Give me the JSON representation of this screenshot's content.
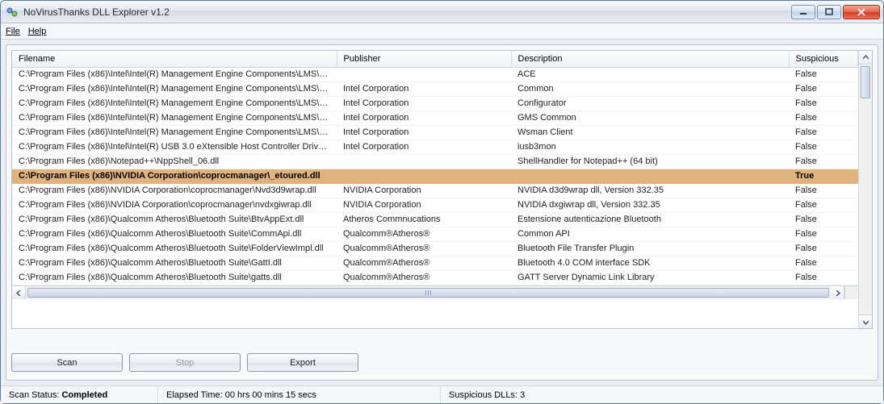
{
  "window": {
    "title": "NoVirusThanks DLL Explorer v1.2"
  },
  "menu": {
    "file": "File",
    "help": "Help"
  },
  "table": {
    "headers": {
      "filename": "Filename",
      "publisher": "Publisher",
      "description": "Description",
      "suspicious": "Suspicious"
    },
    "rows": [
      {
        "filename": "C:\\Program Files (x86)\\Intel\\Intel(R) Management Engine Components\\LMS\\A...",
        "publisher": "",
        "description": "ACE",
        "suspicious": "False",
        "selected": false
      },
      {
        "filename": "C:\\Program Files (x86)\\Intel\\Intel(R) Management Engine Components\\LMS\\Co...",
        "publisher": "Intel Corporation",
        "description": "Common",
        "suspicious": "False",
        "selected": false
      },
      {
        "filename": "C:\\Program Files (x86)\\Intel\\Intel(R) Management Engine Components\\LMS\\Co...",
        "publisher": "Intel Corporation",
        "description": "Configurator",
        "suspicious": "False",
        "selected": false
      },
      {
        "filename": "C:\\Program Files (x86)\\Intel\\Intel(R) Management Engine Components\\LMS\\G...",
        "publisher": "Intel Corporation",
        "description": "GMS Common",
        "suspicious": "False",
        "selected": false
      },
      {
        "filename": "C:\\Program Files (x86)\\Intel\\Intel(R) Management Engine Components\\LMS\\W...",
        "publisher": "Intel Corporation",
        "description": "Wsman Client",
        "suspicious": "False",
        "selected": false
      },
      {
        "filename": "C:\\Program Files (x86)\\Intel\\Intel(R) USB 3.0 eXtensible Host Controller Driver...",
        "publisher": "Intel Corporation",
        "description": "iusb3mon",
        "suspicious": "False",
        "selected": false
      },
      {
        "filename": "C:\\Program Files (x86)\\Notepad++\\NppShell_06.dll",
        "publisher": "",
        "description": "ShellHandler for Notepad++ (64 bit)",
        "suspicious": "False",
        "selected": false
      },
      {
        "filename": "C:\\Program Files (x86)\\NVIDIA Corporation\\coprocmanager\\_etoured.dll",
        "publisher": "",
        "description": "",
        "suspicious": "True",
        "selected": true
      },
      {
        "filename": "C:\\Program Files (x86)\\NVIDIA Corporation\\coprocmanager\\Nvd3d9wrap.dll",
        "publisher": "NVIDIA Corporation",
        "description": "NVIDIA d3d9wrap dll, Version 332.35",
        "suspicious": "False",
        "selected": false
      },
      {
        "filename": "C:\\Program Files (x86)\\NVIDIA Corporation\\coprocmanager\\nvdxgiwrap.dll",
        "publisher": "NVIDIA Corporation",
        "description": "NVIDIA dxgiwrap dll, Version 332.35",
        "suspicious": "False",
        "selected": false
      },
      {
        "filename": "C:\\Program Files (x86)\\Qualcomm Atheros\\Bluetooth Suite\\BtvAppExt.dll",
        "publisher": "Atheros Commnucations",
        "description": "Estensione autenticazione Bluetooth",
        "suspicious": "False",
        "selected": false
      },
      {
        "filename": "C:\\Program Files (x86)\\Qualcomm Atheros\\Bluetooth Suite\\CommApi.dll",
        "publisher": "Qualcomm®Atheros®",
        "description": "Common API",
        "suspicious": "False",
        "selected": false
      },
      {
        "filename": "C:\\Program Files (x86)\\Qualcomm Atheros\\Bluetooth Suite\\FolderViewImpl.dll",
        "publisher": "Qualcomm®Atheros®",
        "description": "Bluetooth File Transfer Plugin",
        "suspicious": "False",
        "selected": false
      },
      {
        "filename": "C:\\Program Files (x86)\\Qualcomm Atheros\\Bluetooth Suite\\GattI.dll",
        "publisher": "Qualcomm®Atheros®",
        "description": "Bluetooth 4.0 COM interface SDK",
        "suspicious": "False",
        "selected": false
      },
      {
        "filename": "C:\\Program Files (x86)\\Qualcomm Atheros\\Bluetooth Suite\\gatts.dll",
        "publisher": "Qualcomm®Atheros®",
        "description": "GATT Server Dynamic Link Library",
        "suspicious": "False",
        "selected": false
      }
    ]
  },
  "buttons": {
    "scan": "Scan",
    "stop": "Stop",
    "export": "Export"
  },
  "status": {
    "scan_label": "Scan Status:",
    "scan_value": "Completed",
    "elapsed_label": "Elapsed Time:",
    "elapsed_value": "00 hrs 00 mins 15 secs",
    "susp_label": "Suspicious DLLs:",
    "susp_value": "3"
  }
}
